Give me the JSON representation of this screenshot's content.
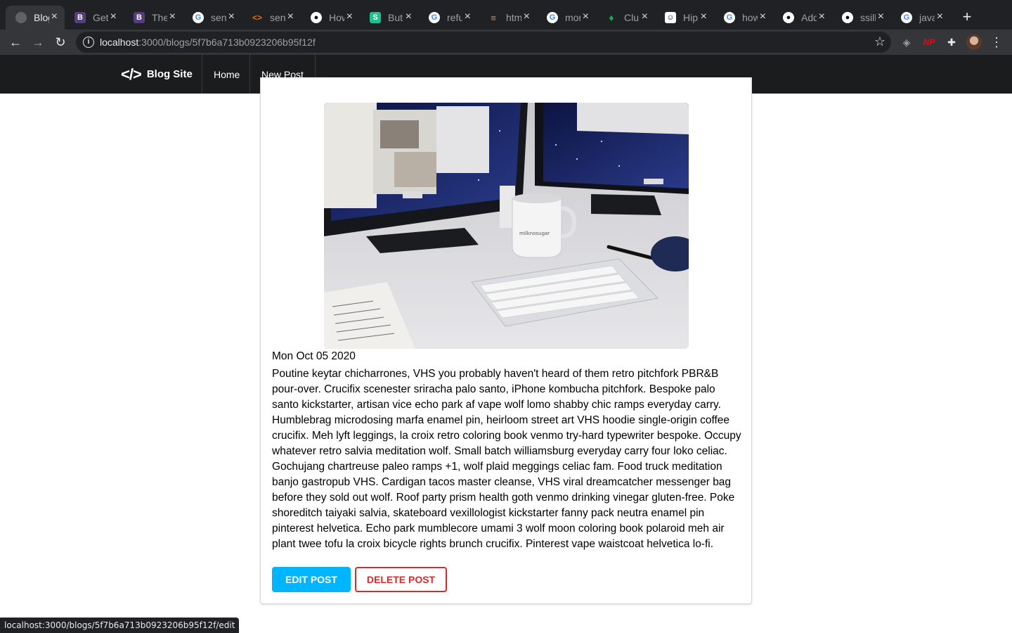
{
  "browser": {
    "tabs": [
      {
        "title": "Blog",
        "favicon": "globe",
        "active": true
      },
      {
        "title": "Get",
        "favicon": "bootstrap"
      },
      {
        "title": "The",
        "favicon": "bootstrap"
      },
      {
        "title": "sen",
        "favicon": "google"
      },
      {
        "title": "sen",
        "favicon": "code"
      },
      {
        "title": "How",
        "favicon": "github"
      },
      {
        "title": "But",
        "favicon": "s-brand"
      },
      {
        "title": "refu",
        "favicon": "google"
      },
      {
        "title": "htm",
        "favicon": "stackoverflow"
      },
      {
        "title": "mor",
        "favicon": "google"
      },
      {
        "title": "Clu",
        "favicon": "leaf"
      },
      {
        "title": "Hip",
        "favicon": "hipster"
      },
      {
        "title": "how",
        "favicon": "google"
      },
      {
        "title": "Add",
        "favicon": "github"
      },
      {
        "title": "ssill",
        "favicon": "github"
      },
      {
        "title": "java",
        "favicon": "google"
      }
    ],
    "url_host": "localhost",
    "url_rest": ":3000/blogs/5f7b6a713b0923206b95f12f",
    "extension_np": "NP",
    "status_url": "localhost:3000/blogs/5f7b6a713b0923206b95f12f/edit"
  },
  "site": {
    "brand": "Blog Site",
    "nav": {
      "home": "Home",
      "new_post": "New Post"
    }
  },
  "post": {
    "image_alt": "desk with monitors, coffee mug and keyboard",
    "date": "Mon Oct 05 2020",
    "body": "Poutine keytar chicharrones, VHS you probably haven't heard of them retro pitchfork PBR&B pour-over. Crucifix scenester sriracha palo santo, iPhone kombucha pitchfork. Bespoke palo santo kickstarter, artisan vice echo park af vape wolf lomo shabby chic ramps everyday carry. Humblebrag microdosing marfa enamel pin, heirloom street art VHS hoodie single-origin coffee crucifix. Meh lyft leggings, la croix retro coloring book venmo try-hard typewriter bespoke. Occupy whatever retro salvia meditation wolf. Small batch williamsburg everyday carry four loko celiac. Gochujang chartreuse paleo ramps +1, wolf plaid meggings celiac fam. Food truck meditation banjo gastropub VHS. Cardigan tacos master cleanse, VHS viral dreamcatcher messenger bag before they sold out wolf. Roof party prism health goth venmo drinking vinegar gluten-free. Poke shoreditch taiyaki salvia, skateboard vexillologist kickstarter fanny pack neutra enamel pin pinterest helvetica. Echo park mumblecore umami 3 wolf moon coloring book polaroid meh air plant twee tofu la croix bicycle rights brunch crucifix. Pinterest vape waistcoat helvetica lo-fi.",
    "edit_label": "EDIT POST",
    "delete_label": "DELETE POST"
  },
  "colors": {
    "edit_button": "#00b5ff",
    "delete_button": "#db2828",
    "navbar": "#1b1c1d"
  }
}
